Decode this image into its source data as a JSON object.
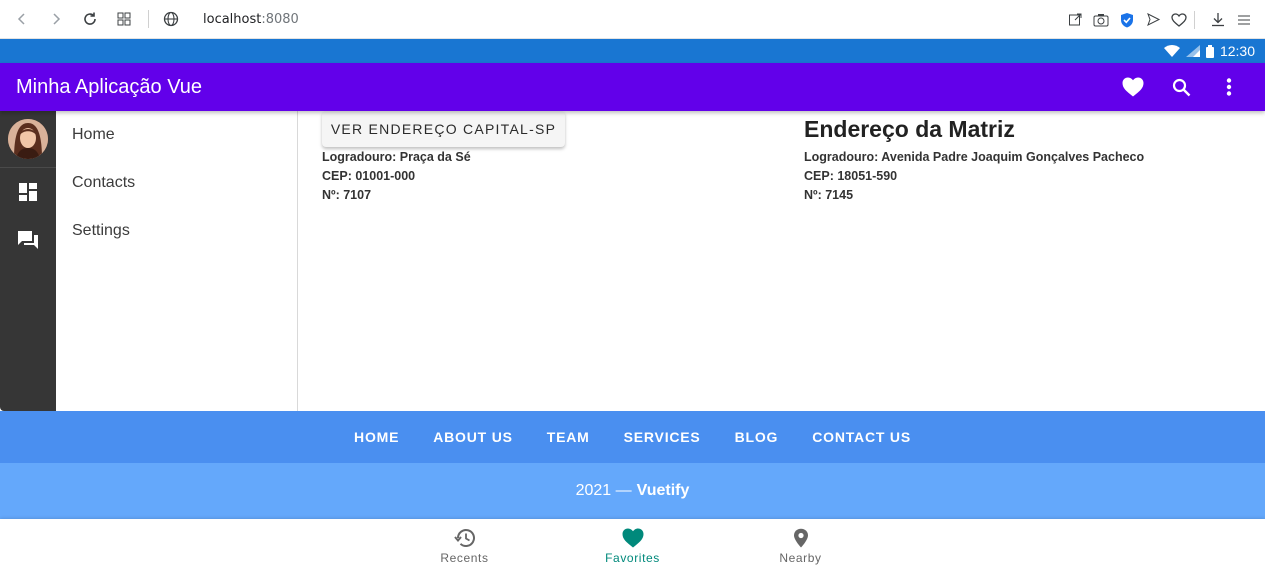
{
  "browser": {
    "url_host": "localhost",
    "url_port": ":8080"
  },
  "status_bar": {
    "time": "12:30"
  },
  "app_bar": {
    "title": "Minha Aplicação Vue",
    "color": "#6200ea"
  },
  "nav": {
    "items": [
      {
        "label": "Home"
      },
      {
        "label": "Contacts"
      },
      {
        "label": "Settings"
      }
    ]
  },
  "content": {
    "button_label": "VER ENDEREÇO CAPITAL-SP",
    "capital": {
      "logradouro": "Logradouro: Praça da Sé",
      "cep": "CEP: 01001-000",
      "numero": "Nº: 7107"
    },
    "matriz": {
      "title": "Endereço da Matriz",
      "logradouro": "Logradouro: Avenida Padre Joaquim Gonçalves Pacheco",
      "cep": "CEP: 18051-590",
      "numero": "Nº: 7145"
    }
  },
  "footer": {
    "links": [
      "HOME",
      "ABOUT US",
      "TEAM",
      "SERVICES",
      "BLOG",
      "CONTACT US"
    ],
    "year_text": "2021 —",
    "brand": "Vuetify"
  },
  "bottom_nav": {
    "items": [
      {
        "label": "Recents",
        "icon": "history-icon"
      },
      {
        "label": "Favorites",
        "icon": "heart-icon",
        "active": true
      },
      {
        "label": "Nearby",
        "icon": "map-marker-icon"
      }
    ],
    "active_color": "#00897b"
  }
}
